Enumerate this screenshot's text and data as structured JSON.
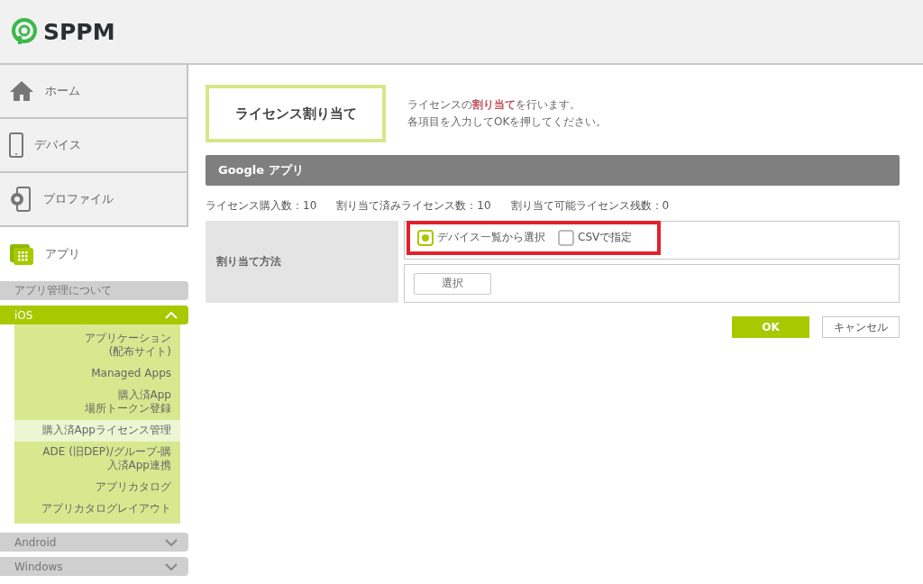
{
  "logo": {
    "text": "SPPM"
  },
  "nav": [
    {
      "kind": "home",
      "label": "ホーム",
      "selected": false
    },
    {
      "kind": "device",
      "label": "デバイス",
      "selected": false
    },
    {
      "kind": "profile",
      "label": "プロファイル",
      "selected": false
    },
    {
      "kind": "app",
      "label": "アプリ",
      "selected": true
    }
  ],
  "app_menu": {
    "about": "アプリ管理について",
    "groups": [
      {
        "label": "iOS",
        "expanded": true,
        "children": [
          {
            "lines": [
              "アプリケーション",
              "(配布サイト)"
            ],
            "selected": false
          },
          {
            "lines": [
              "Managed Apps"
            ],
            "selected": false
          },
          {
            "lines": [
              "購入済App",
              "場所トークン登録"
            ],
            "selected": false
          },
          {
            "lines": [
              "購入済Appライセンス管理"
            ],
            "selected": true
          },
          {
            "lines": [
              "ADE (旧DEP)/グループ-購",
              "入済App連携"
            ],
            "selected": false
          },
          {
            "lines": [
              "アプリカタログ"
            ],
            "selected": false
          },
          {
            "lines": [
              "アプリカタログレイアウト"
            ],
            "selected": false
          }
        ]
      },
      {
        "label": "Android",
        "expanded": false
      },
      {
        "label": "Windows",
        "expanded": false
      }
    ]
  },
  "page": {
    "title": "ライセンス割り当て",
    "description": [
      "ライセンスの**割り当て**を行います。",
      "各項目を入力してOKを押してください。"
    ]
  },
  "section": {
    "title": "Google アプリ",
    "stats": [
      "ライセンス購入数：10",
      "割り当て済みライセンス数：10",
      "割り当て可能ライセンス残数：0"
    ]
  },
  "form": {
    "label": "割り当て方法",
    "highlighted": true,
    "options": [
      {
        "label": "デバイス一覧から選択",
        "selected": true
      },
      {
        "label": "CSVで指定",
        "selected": false
      }
    ],
    "select_button": "選択"
  },
  "buttons": {
    "ok": "OK",
    "cancel": "キャンセル"
  }
}
